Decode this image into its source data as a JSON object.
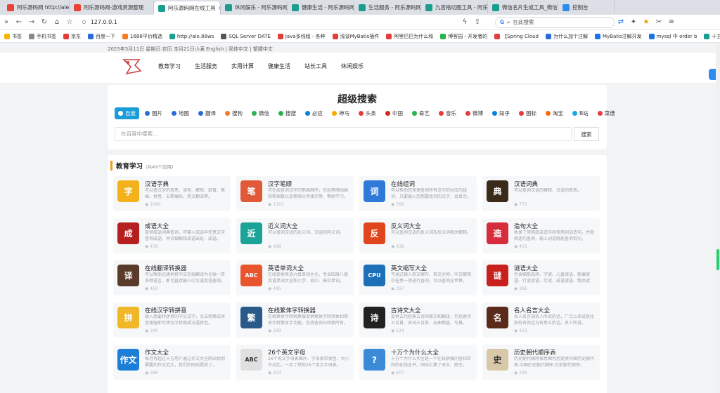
{
  "browser": {
    "tabs": [
      {
        "label": "阿乐源码网 http://ale.lele",
        "active": false,
        "color": "#e94335"
      },
      {
        "label": "阿乐源码网-游戏资源整理",
        "active": false,
        "color": "#e94335"
      },
      {
        "label": "阿乐源码网在线工具",
        "active": true,
        "color": "#1a9e8f"
      },
      {
        "label": "休闲娱乐 - 阿乐源码网在",
        "active": false,
        "color": "#1a9e8f"
      },
      {
        "label": "健康生活 - 阿乐源码网在",
        "active": false,
        "color": "#1a9e8f"
      },
      {
        "label": "生活服务 - 阿乐源码网在",
        "active": false,
        "color": "#1a9e8f"
      },
      {
        "label": "九宫格切图工具 - 阿乐源",
        "active": false,
        "color": "#1a9e8f"
      },
      {
        "label": "微信名片生成工具_微信名",
        "active": false,
        "color": "#1a9e8f"
      },
      {
        "label": "控制台",
        "active": false,
        "color": "#2d8cf0"
      }
    ],
    "url": "127.0.0.1",
    "search_placeholder": "在此搜索",
    "bookmarks": [
      "书签",
      "手机书签",
      "京东",
      "百度一下",
      "1688平价精选",
      "http://ale.88ws",
      "SQL Server DATE",
      "Java多线程 - 各种",
      "浅谈MyBatis插件",
      "阿里巴巴为什么和",
      "博客园 - 开发者的",
      "【Spring Cloud",
      "为什么加个注解",
      "MyBatis注解开发",
      "mysql 中 order b",
      "十五分钟用Spr"
    ]
  },
  "site": {
    "topline": "2025年5月11日 星期日 农历 本月21日小满  English | 简体中文 | 繁體中文",
    "nav": [
      "教育学习",
      "生活服务",
      "实用计算",
      "健康生活",
      "站长工具",
      "休闲娱乐"
    ]
  },
  "search": {
    "title": "超级搜索",
    "engines": [
      {
        "label": "百度",
        "color": "#2d6bd8"
      },
      {
        "label": "图片",
        "color": "#2d6bd8"
      },
      {
        "label": "地图",
        "color": "#2d6bd8"
      },
      {
        "label": "翻译",
        "color": "#2d6bd8"
      },
      {
        "label": "搜狗",
        "color": "#f57c21"
      },
      {
        "label": "微信",
        "color": "#2bb24c"
      },
      {
        "label": "搜搜",
        "color": "#2bb24c"
      },
      {
        "label": "必应",
        "color": "#0a84d8"
      },
      {
        "label": "神马",
        "color": "#f7a800"
      },
      {
        "label": "头条",
        "color": "#e53b3b"
      },
      {
        "label": "中国",
        "color": "#d9261c"
      },
      {
        "label": "奇艺",
        "color": "#2bb24c"
      },
      {
        "label": "音乐",
        "color": "#e53b3b"
      },
      {
        "label": "微博",
        "color": "#e53b3b"
      },
      {
        "label": "知乎",
        "color": "#0a84d8"
      },
      {
        "label": "图标",
        "color": "#e53b3b"
      },
      {
        "label": "淘宝",
        "color": "#ff6a00"
      },
      {
        "label": "B站",
        "color": "#17a9e1"
      },
      {
        "label": "菜谱",
        "color": "#e53b3b"
      }
    ],
    "placeholder": "在百度中搜索...",
    "button": "搜索"
  },
  "section": {
    "title": "教育学习",
    "count": "(共49个应用)",
    "apps": [
      {
        "name": "汉语字典",
        "desc": "可以查汉字的意思、读音、解释、部首、笔画、拼音、五笔编码、英文翻译等。",
        "views": "1090",
        "icon": "字",
        "color": "#f3b21c"
      },
      {
        "name": "汉字笔顺",
        "desc": "可在线查询汉字的笔画顺序，包括笔顺动画和笔画数以及笔顺分步演示等，帮助学习。",
        "views": "1163",
        "icon": "笔",
        "color": "#e05a3a"
      },
      {
        "name": "在线组词",
        "desc": "可以帮助您快速查询所有汉字的对应的组词，只要输入您想要组词的汉字，会显示。",
        "views": "766",
        "icon": "词",
        "color": "#2f7ad8"
      },
      {
        "name": "汉语词典",
        "desc": "可以查询汉语的解释、汉语的意思。",
        "views": "775",
        "icon": "典",
        "color": "#3a2a1a"
      },
      {
        "name": "成语大全",
        "desc": "提供成语词典查询，可输入成语中任意文字查询成语，并详细解释成语出处、成语。",
        "views": "476",
        "icon": "成",
        "color": "#b51f1f"
      },
      {
        "name": "近义词大全",
        "desc": "可以查询汉语的近义词、汉语的同义词。",
        "views": "488",
        "icon": "近",
        "color": "#1aa396"
      },
      {
        "name": "反义词大全",
        "desc": "可以查询汉语的反义词及反义词相关解释。",
        "views": "438",
        "icon": "反",
        "color": "#e0461e"
      },
      {
        "name": "造句大全",
        "desc": "收录了常用成语造句和常用词语造句，并提供造句查询，输入词语就能查询到句。",
        "views": "403",
        "icon": "造",
        "color": "#d62c3c"
      },
      {
        "name": "在线翻译转换器",
        "desc": "可以帮助迅速地将中文在线翻译为全球一百多种语言，即可直接输入中文或英语查询。",
        "views": "450",
        "icon": "译",
        "color": "#5a3a2a"
      },
      {
        "name": "英语单词大全",
        "desc": "在线提供英语六级单词大全，专业四级八级英语单词大全和小学、初中、高中单词。",
        "views": "495",
        "icon": "ABC",
        "color": "#e8542c"
      },
      {
        "name": "英文缩写大全",
        "desc": "可通过输入英文缩写、英文全称、中文解释中任意一项进行查询，可以查询全世界。",
        "views": "397",
        "icon": "CPU",
        "color": "#1d6fb8"
      },
      {
        "name": "谜语大全",
        "desc": "包含脑筋急转、字谜、儿童谜语、新编谜语、灯谜谜语、灯谜、成语谜语、物品谜语。",
        "views": "366",
        "icon": "谜",
        "color": "#c8201d"
      },
      {
        "name": "在线汉字转拼音",
        "desc": "输入想要转拼音的中文汉字，点击转换成拼音按钮即可将汉字转换成汉语拼音。",
        "views": "340",
        "icon": "拼",
        "color": "#f0b828"
      },
      {
        "name": "在线繁体字转换器",
        "desc": "在线繁体字转转换器提供繁体字转简体和简体字转繁体字功能，在线查询与转换所有。",
        "views": "299",
        "icon": "繁",
        "color": "#2a5a8a"
      },
      {
        "name": "古诗文大全",
        "desc": "提供古代经典古诗的原文和翻译，包括唐诗三百首、宋词三百首、元曲精选、写景。",
        "views": "524",
        "icon": "诗",
        "color": "#222222"
      },
      {
        "name": "名人名言大全",
        "desc": "名人名言指名人所说的话，广泛上来说是比如有名的话与有意义的话。名人所说。",
        "views": "413",
        "icon": "名",
        "color": "#5a2a1a"
      },
      {
        "name": "作文大全",
        "desc": "每月有超过十万用户通过作文大全网站找到需要的作文范文，我们的网站提供了。",
        "views": "368",
        "icon": "作文",
        "color": "#1d7ed8"
      },
      {
        "name": "26个英文字母",
        "desc": "26个英文字母表图片、字母表带发音、大小写对比，一目了然的26个英文字母表。",
        "views": "314",
        "icon": "ABC",
        "color": "#e0e0e0"
      },
      {
        "name": "十万个为什么大全",
        "desc": "十万个为什么大全是一个在线供稿问答和百科的在线全书，网站汇集了天文、航空。",
        "views": "607",
        "icon": "?",
        "color": "#3a8ad8"
      },
      {
        "name": "历史朝代顺序表",
        "desc": "历史朝代顺序表意图为您提供中国历史朝代表,中国历史朝代顺序,历史朝代顺序。",
        "views": "330",
        "icon": "史",
        "color": "#d8c8a8"
      }
    ]
  }
}
